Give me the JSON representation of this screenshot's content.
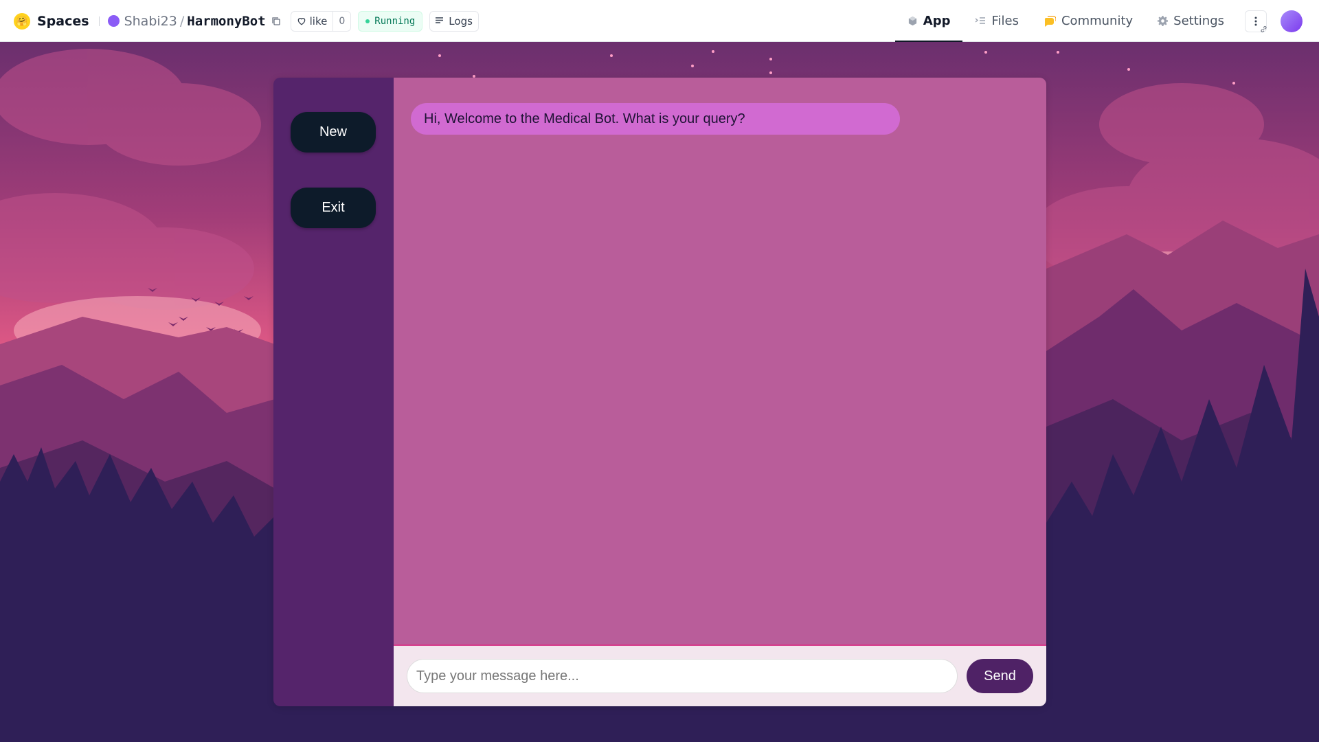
{
  "header": {
    "logo_icon": "hugging-face-emoji-icon",
    "spaces_label": "Spaces",
    "owner": "Shabi23",
    "separator": "/",
    "repo": "HarmonyBot",
    "like_label": "like",
    "like_count": "0",
    "status": "Running",
    "logs_label": "Logs",
    "tabs": [
      {
        "label": "App",
        "icon": "app-cube-icon",
        "active": true
      },
      {
        "label": "Files",
        "icon": "files-icon",
        "active": false
      },
      {
        "label": "Community",
        "icon": "community-icon",
        "active": false
      },
      {
        "label": "Settings",
        "icon": "gear-icon",
        "active": false
      }
    ]
  },
  "sidebar": {
    "new_label": "New",
    "exit_label": "Exit"
  },
  "chat": {
    "messages": [
      {
        "role": "bot",
        "text": "Hi, Welcome to the Medical Bot. What is your query?"
      }
    ],
    "input_placeholder": "Type your message here...",
    "input_value": "",
    "send_label": "Send"
  },
  "colors": {
    "sidebar": "#55246b",
    "chat_bg": "#b95d9a",
    "bot_bubble": "#d16ad1",
    "button_dark": "#0d1b2a",
    "send_button": "#4f2266",
    "status_green": "#047857"
  }
}
